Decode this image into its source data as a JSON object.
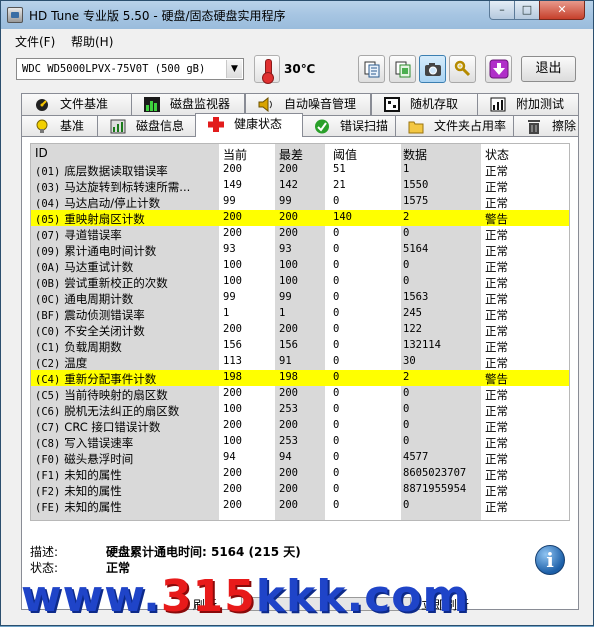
{
  "window": {
    "title": "HD Tune 专业版 5.50 - 硬盘/固态硬盘实用程序"
  },
  "menu": {
    "file": "文件(F)",
    "help": "帮助(H)"
  },
  "toolbar": {
    "drive": "WDC WD5000LPVX-75V0T (500 gB)",
    "temperature": "30℃",
    "exit_label": "退出",
    "buttons": [
      "copy-text-icon",
      "copy-screenshot-icon",
      "camera-icon",
      "options-icon",
      "save-icon"
    ]
  },
  "tabs": {
    "row1": [
      "文件基准",
      "磁盘监视器",
      "自动噪音管理",
      "随机存取",
      "附加测试"
    ],
    "row2": [
      "基准",
      "磁盘信息",
      "健康状态",
      "错误扫描",
      "文件夹占用率",
      "擦除"
    ],
    "active": "健康状态"
  },
  "grid": {
    "headers": {
      "id": "ID",
      "current": "当前",
      "worst": "最差",
      "threshold": "阈值",
      "data": "数据",
      "status": "状态"
    },
    "rows": [
      {
        "code": "(01)",
        "name": "底层数据读取错误率",
        "current": "200",
        "worst": "200",
        "threshold": "51",
        "data": "1",
        "status": "正常",
        "warn": false
      },
      {
        "code": "(03)",
        "name": "马达旋转到标转速所需...",
        "current": "149",
        "worst": "142",
        "threshold": "21",
        "data": "1550",
        "status": "正常",
        "warn": false
      },
      {
        "code": "(04)",
        "name": "马达启动/停止计数",
        "current": "99",
        "worst": "99",
        "threshold": "0",
        "data": "1575",
        "status": "正常",
        "warn": false
      },
      {
        "code": "(05)",
        "name": "重映射扇区计数",
        "current": "200",
        "worst": "200",
        "threshold": "140",
        "data": "2",
        "status": "警告",
        "warn": true
      },
      {
        "code": "(07)",
        "name": "寻道错误率",
        "current": "200",
        "worst": "200",
        "threshold": "0",
        "data": "0",
        "status": "正常",
        "warn": false
      },
      {
        "code": "(09)",
        "name": "累计通电时间计数",
        "current": "93",
        "worst": "93",
        "threshold": "0",
        "data": "5164",
        "status": "正常",
        "warn": false
      },
      {
        "code": "(0A)",
        "name": "马达重试计数",
        "current": "100",
        "worst": "100",
        "threshold": "0",
        "data": "0",
        "status": "正常",
        "warn": false
      },
      {
        "code": "(0B)",
        "name": "尝试重新校正的次数",
        "current": "100",
        "worst": "100",
        "threshold": "0",
        "data": "0",
        "status": "正常",
        "warn": false
      },
      {
        "code": "(0C)",
        "name": "通电周期计数",
        "current": "99",
        "worst": "99",
        "threshold": "0",
        "data": "1563",
        "status": "正常",
        "warn": false
      },
      {
        "code": "(BF)",
        "name": "震动侦测错误率",
        "current": "1",
        "worst": "1",
        "threshold": "0",
        "data": "245",
        "status": "正常",
        "warn": false
      },
      {
        "code": "(C0)",
        "name": "不安全关闭计数",
        "current": "200",
        "worst": "200",
        "threshold": "0",
        "data": "122",
        "status": "正常",
        "warn": false
      },
      {
        "code": "(C1)",
        "name": "负载周期数",
        "current": "156",
        "worst": "156",
        "threshold": "0",
        "data": "132114",
        "status": "正常",
        "warn": false
      },
      {
        "code": "(C2)",
        "name": "温度",
        "current": "113",
        "worst": "91",
        "threshold": "0",
        "data": "30",
        "status": "正常",
        "warn": false
      },
      {
        "code": "(C4)",
        "name": "重新分配事件计数",
        "current": "198",
        "worst": "198",
        "threshold": "0",
        "data": "2",
        "status": "警告",
        "warn": true
      },
      {
        "code": "(C5)",
        "name": "当前待映射的扇区数",
        "current": "200",
        "worst": "200",
        "threshold": "0",
        "data": "0",
        "status": "正常",
        "warn": false
      },
      {
        "code": "(C6)",
        "name": "脱机无法纠正的扇区数",
        "current": "100",
        "worst": "253",
        "threshold": "0",
        "data": "0",
        "status": "正常",
        "warn": false
      },
      {
        "code": "(C7)",
        "name": "CRC 接口错误计数",
        "current": "200",
        "worst": "200",
        "threshold": "0",
        "data": "0",
        "status": "正常",
        "warn": false
      },
      {
        "code": "(C8)",
        "name": "写入错误速率",
        "current": "100",
        "worst": "253",
        "threshold": "0",
        "data": "0",
        "status": "正常",
        "warn": false
      },
      {
        "code": "(F0)",
        "name": "磁头悬浮时间",
        "current": "94",
        "worst": "94",
        "threshold": "0",
        "data": "4577",
        "status": "正常",
        "warn": false
      },
      {
        "code": "(F1)",
        "name": "未知的属性",
        "current": "200",
        "worst": "200",
        "threshold": "0",
        "data": "8605023707",
        "status": "正常",
        "warn": false
      },
      {
        "code": "(F2)",
        "name": "未知的属性",
        "current": "200",
        "worst": "200",
        "threshold": "0",
        "data": "8871955954",
        "status": "正常",
        "warn": false
      },
      {
        "code": "(FE)",
        "name": "未知的属性",
        "current": "200",
        "worst": "200",
        "threshold": "0",
        "data": "0",
        "status": "正常",
        "warn": false
      }
    ]
  },
  "info": {
    "desc_label": "描述:",
    "desc_value": "硬盘累计通电时间: 5164 (215 天)",
    "status_label": "状态:",
    "status_value": "正常"
  },
  "bottom": {
    "left_label": "健",
    "middle_label": "刷新",
    "right_label": "立即刷新"
  },
  "watermark": {
    "prefix": "www.",
    "number": "315",
    "suffix": "kkk.com"
  },
  "colors": {
    "warning_highlight": "#ffff00",
    "stripe": "#d9d9d9",
    "watermark_blue": "#1f44c8",
    "watermark_red": "#e81a1a"
  }
}
